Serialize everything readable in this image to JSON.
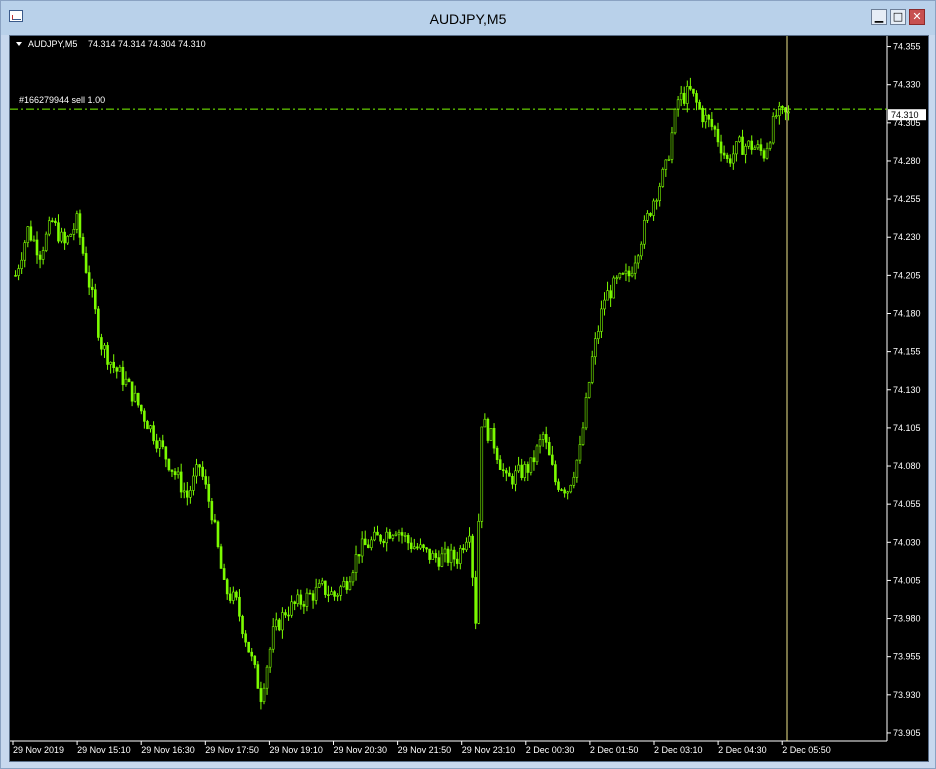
{
  "window": {
    "title": "AUDJPY,M5",
    "minimize_icon": "minimize-icon",
    "maximize_icon": "maximize-icon",
    "close_icon": "close-icon"
  },
  "chart_info": {
    "symbol_label": "AUDJPY,M5",
    "ohlc_label": "74.314 74.314 74.304 74.310",
    "order_label": "#166279944 sell 1.00",
    "current_price_label": "74.310"
  },
  "colors": {
    "background": "#000000",
    "candles": "#7cfc00",
    "axis": "#ffffff",
    "order_line": "#7cfc00",
    "cursor_line": "#f0e68c"
  },
  "chart_data": {
    "type": "candlestick",
    "symbol": "AUDJPY",
    "timeframe": "M5",
    "y_ticks": [
      74.355,
      74.33,
      74.305,
      74.28,
      74.255,
      74.23,
      74.205,
      74.18,
      74.155,
      74.13,
      74.105,
      74.08,
      74.055,
      74.03,
      74.005,
      73.98,
      73.955,
      73.93,
      73.905
    ],
    "ylim": [
      73.903,
      74.358
    ],
    "x_ticks": [
      "29 Nov 2019",
      "29 Nov 15:10",
      "29 Nov 16:30",
      "29 Nov 17:50",
      "29 Nov 19:10",
      "29 Nov 20:30",
      "29 Nov 21:50",
      "29 Nov 23:10",
      "2 Dec 00:30",
      "2 Dec 01:50",
      "2 Dec 03:10",
      "2 Dec 04:30",
      "2 Dec 05:50"
    ],
    "order_line_price": 74.314,
    "current_price": 74.31,
    "close_path": [
      [
        0,
        74.205
      ],
      [
        4,
        74.235
      ],
      [
        8,
        74.22
      ],
      [
        12,
        74.24
      ],
      [
        16,
        74.225
      ],
      [
        20,
        74.24
      ],
      [
        24,
        74.2
      ],
      [
        28,
        74.16
      ],
      [
        32,
        74.145
      ],
      [
        36,
        74.135
      ],
      [
        40,
        74.12
      ],
      [
        44,
        74.105
      ],
      [
        48,
        74.09
      ],
      [
        52,
        74.075
      ],
      [
        56,
        74.06
      ],
      [
        60,
        74.08
      ],
      [
        64,
        74.05
      ],
      [
        68,
        74.0
      ],
      [
        72,
        73.99
      ],
      [
        76,
        73.96
      ],
      [
        80,
        73.93
      ],
      [
        84,
        73.97
      ],
      [
        88,
        73.985
      ],
      [
        92,
        73.99
      ],
      [
        96,
        73.995
      ],
      [
        100,
        74.0
      ],
      [
        104,
        73.995
      ],
      [
        108,
        74.005
      ],
      [
        112,
        74.025
      ],
      [
        116,
        74.03
      ],
      [
        120,
        74.035
      ],
      [
        124,
        74.04
      ],
      [
        128,
        74.03
      ],
      [
        132,
        74.025
      ],
      [
        136,
        74.02
      ],
      [
        140,
        74.02
      ],
      [
        144,
        74.02
      ],
      [
        148,
        74.04
      ],
      [
        150,
        73.98
      ],
      [
        152,
        74.11
      ],
      [
        156,
        74.095
      ],
      [
        160,
        74.07
      ],
      [
        164,
        74.075
      ],
      [
        168,
        74.08
      ],
      [
        172,
        74.1
      ],
      [
        176,
        74.07
      ],
      [
        180,
        74.065
      ],
      [
        184,
        74.09
      ],
      [
        188,
        74.15
      ],
      [
        192,
        74.19
      ],
      [
        196,
        74.2
      ],
      [
        200,
        74.205
      ],
      [
        204,
        74.23
      ],
      [
        208,
        74.255
      ],
      [
        212,
        74.275
      ],
      [
        216,
        74.32
      ],
      [
        220,
        74.325
      ],
      [
        224,
        74.31
      ],
      [
        228,
        74.3
      ],
      [
        232,
        74.28
      ],
      [
        236,
        74.29
      ],
      [
        240,
        74.29
      ],
      [
        244,
        74.285
      ],
      [
        248,
        74.31
      ],
      [
        252,
        74.31
      ]
    ],
    "bars_visible": 252
  }
}
